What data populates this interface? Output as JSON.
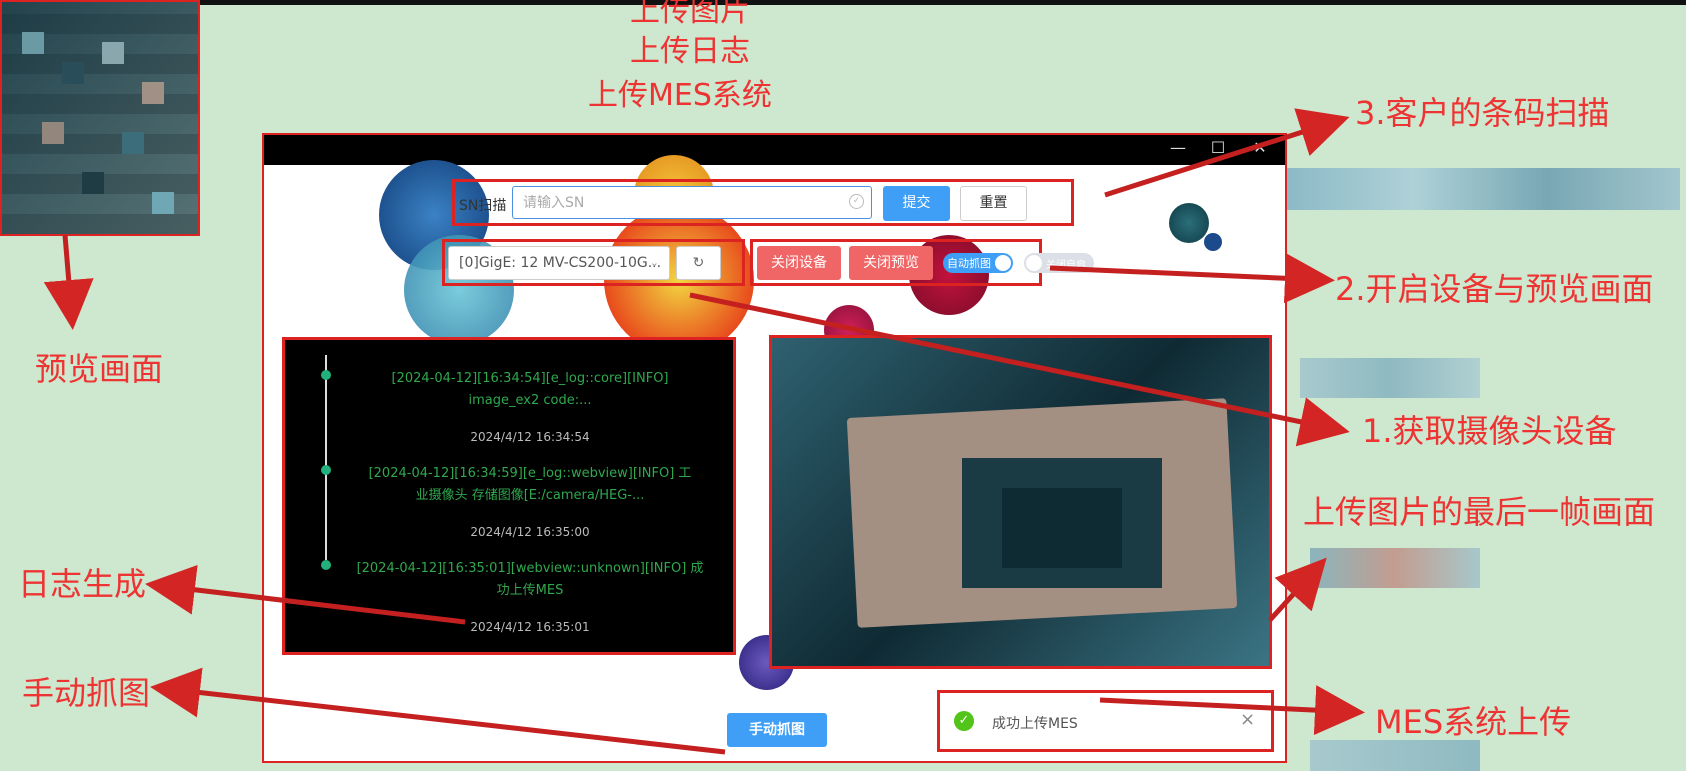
{
  "annotations": {
    "top_lines": [
      "上传图片",
      "上传日志",
      "上传MES系统"
    ],
    "barcode": "3.客户的条码扫描",
    "device_preview": "2.开启设备与预览画面",
    "camera": "1.获取摄像头设备",
    "last_frame": "上传图片的最后一帧画面",
    "mes_upload": "MES系统上传",
    "preview": "预览画面",
    "log_gen": "日志生成",
    "manual": "手动抓图"
  },
  "window": {
    "minimize": "—",
    "maximize": "☐",
    "close": "✕"
  },
  "sn": {
    "label": "SN扫描",
    "placeholder": "请输入SN",
    "submit_label": "提交",
    "reset_label": "重置"
  },
  "device": {
    "selected": "[0]GigE: 12 MV-CS200-10G...",
    "close_device_label": "关闭设备",
    "close_preview_label": "关闭预览",
    "auto_capture_label": "自动抓图",
    "auto_start_label": "关闭自启"
  },
  "log": {
    "entries": [
      {
        "text1": "[2024-04-12][16:34:54][e_log::core][INFO]",
        "text2": "image_ex2 code:...",
        "time": "2024/4/12 16:34:54"
      },
      {
        "text1": "[2024-04-12][16:34:59][e_log::webview][INFO] 工",
        "text2": "业摄像头 存储图像[E:/camera/HEG-...",
        "time": "2024/4/12 16:35:00"
      },
      {
        "text1": "[2024-04-12][16:35:01][webview::unknown][INFO] 成",
        "text2": "功上传MES",
        "time": "2024/4/12 16:35:01"
      }
    ]
  },
  "manual_capture_label": "手动抓图",
  "toast": {
    "message": "成功上传MES",
    "close": "×"
  },
  "colors": {
    "annotation": "#e33",
    "primary": "#3f9ff7",
    "danger": "#f06565",
    "log_text": "#2fa84e",
    "success": "#52c41a"
  }
}
